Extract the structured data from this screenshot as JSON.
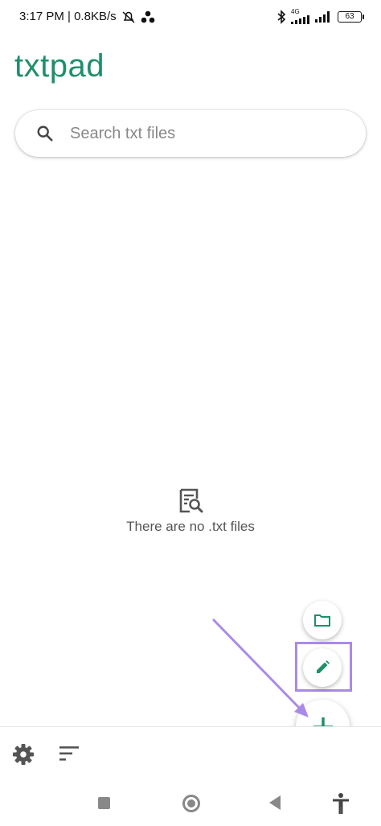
{
  "status_bar": {
    "time_speed": "3:17 PM | 0.8KB/s",
    "network_label": "4G",
    "battery": "63"
  },
  "app": {
    "title": "txtpad"
  },
  "search": {
    "placeholder": "Search txt files",
    "value": ""
  },
  "empty_state": {
    "message": "There are no .txt files"
  },
  "fabs": {
    "items": [
      "folder-icon",
      "pencil-icon",
      "plus-icon"
    ]
  },
  "bottom_bar": {
    "items": [
      "gear-icon",
      "sort-icon"
    ]
  },
  "system_nav": {
    "items": [
      "recent-apps",
      "home",
      "back",
      "accessibility"
    ]
  },
  "colors": {
    "accent": "#1e8f6b",
    "annotation": "#a98ae8"
  }
}
